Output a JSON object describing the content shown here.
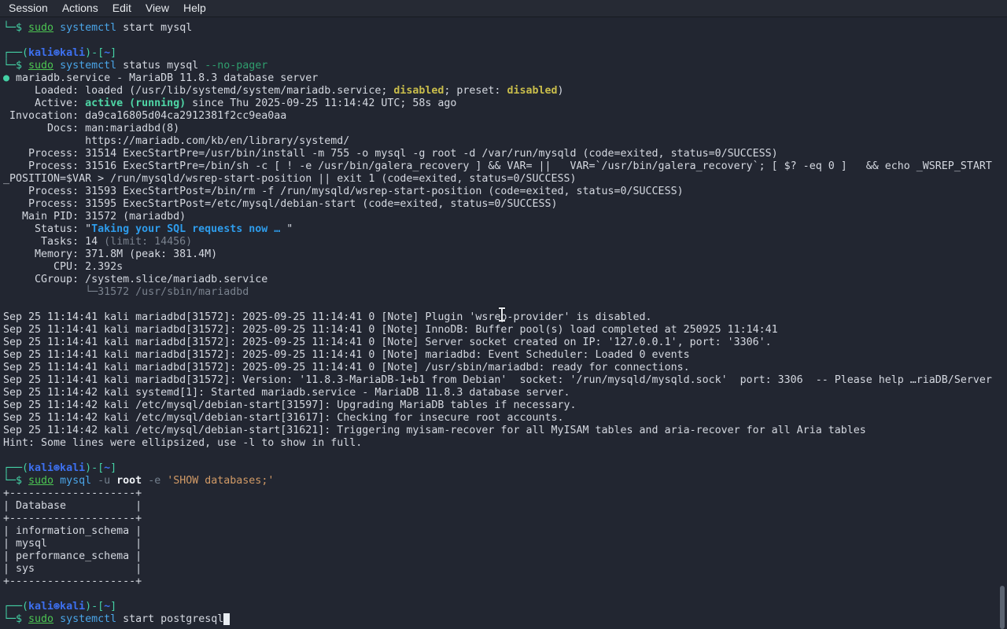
{
  "menubar": {
    "items": [
      "Session",
      "Actions",
      "Edit",
      "View",
      "Help"
    ]
  },
  "palette": {
    "bg": "#222631",
    "menubar": "#262a34",
    "fg": "#d4d8e0",
    "dim": "#7a828e",
    "teal": "#44d1a5",
    "green": "#4cc552",
    "green-bold": "#4fd6a6",
    "yellow": "#c9bd4b",
    "blue-cmd": "#4aa5e8",
    "blue-name": "#3d70f0",
    "blue-status": "#2e9ceb",
    "orange": "#d19a66",
    "opt-green": "#2f9e6e",
    "opt-gray": "#74808e",
    "white-bold": "#eef1f5",
    "cursor": "#e9edf2",
    "scrollbar": "#5b6370"
  },
  "terminal": {
    "lines": [
      [
        {
          "t": "└─$ ",
          "s": "teal"
        },
        {
          "t": "sudo",
          "s": "ul"
        },
        {
          "t": " "
        },
        {
          "t": "systemctl",
          "s": "cmd"
        },
        {
          "t": " start mysql"
        }
      ],
      "",
      [
        {
          "t": "┌──(",
          "s": "teal"
        },
        {
          "t": "kali⊛kali",
          "s": "nb"
        },
        {
          "t": ")-[",
          "s": "teal"
        },
        {
          "t": "~",
          "s": "nb"
        },
        {
          "t": "]",
          "s": "teal"
        }
      ],
      [
        {
          "t": "└─$ ",
          "s": "teal"
        },
        {
          "t": "sudo",
          "s": "ul"
        },
        {
          "t": " "
        },
        {
          "t": "systemctl",
          "s": "cmd"
        },
        {
          "t": " status mysql "
        },
        {
          "t": "--no-pager",
          "s": "optg"
        }
      ],
      [
        {
          "t": "●",
          "s": "teal"
        },
        {
          "t": " mariadb.service - MariaDB 11.8.3 database server"
        }
      ],
      [
        {
          "t": "     Loaded: loaded (/usr/lib/systemd/system/mariadb.service; "
        },
        {
          "t": "disabled",
          "s": "yb"
        },
        {
          "t": "; preset: "
        },
        {
          "t": "disabled",
          "s": "yb"
        },
        {
          "t": ")"
        }
      ],
      [
        {
          "t": "     Active: "
        },
        {
          "t": "active (running)",
          "s": "gb"
        },
        {
          "t": " since Thu 2025-09-25 11:14:42 UTC; 58s ago"
        }
      ],
      " Invocation: da9ca16805d04ca2912381f2cc9ea0aa",
      "       Docs: man:mariadbd(8)",
      "             https://mariadb.com/kb/en/library/systemd/",
      "    Process: 31514 ExecStartPre=/usr/bin/install -m 755 -o mysql -g root -d /var/run/mysqld (code=exited, status=0/SUCCESS)",
      "    Process: 31516 ExecStartPre=/bin/sh -c [ ! -e /usr/bin/galera_recovery ] && VAR= ||   VAR=`/usr/bin/galera_recovery`; [ $? -eq 0 ]   && echo _WSREP_START",
      "_POSITION=$VAR > /run/mysqld/wsrep-start-position || exit 1 (code=exited, status=0/SUCCESS)",
      "    Process: 31593 ExecStartPost=/bin/rm -f /run/mysqld/wsrep-start-position (code=exited, status=0/SUCCESS)",
      "    Process: 31595 ExecStartPost=/etc/mysql/debian-start (code=exited, status=0/SUCCESS)",
      "   Main PID: 31572 (mariadbd)",
      [
        {
          "t": "     Status: \""
        },
        {
          "t": "Taking your SQL requests now … ",
          "s": "sb"
        },
        {
          "t": "\""
        }
      ],
      [
        {
          "t": "      Tasks: 14 "
        },
        {
          "t": "(limit: 14456)",
          "s": "dim"
        }
      ],
      "     Memory: 371.8M (peak: 381.4M)",
      "        CPU: 2.392s",
      "     CGroup: /system.slice/mariadb.service",
      [
        {
          "t": "             "
        },
        {
          "t": "└─31572 /usr/sbin/mariadbd",
          "s": "dim"
        }
      ],
      "",
      "Sep 25 11:14:41 kali mariadbd[31572]: 2025-09-25 11:14:41 0 [Note] Plugin 'wsrep-provider' is disabled.",
      "Sep 25 11:14:41 kali mariadbd[31572]: 2025-09-25 11:14:41 0 [Note] InnoDB: Buffer pool(s) load completed at 250925 11:14:41",
      "Sep 25 11:14:41 kali mariadbd[31572]: 2025-09-25 11:14:41 0 [Note] Server socket created on IP: '127.0.0.1', port: '3306'.",
      "Sep 25 11:14:41 kali mariadbd[31572]: 2025-09-25 11:14:41 0 [Note] mariadbd: Event Scheduler: Loaded 0 events",
      "Sep 25 11:14:41 kali mariadbd[31572]: 2025-09-25 11:14:41 0 [Note] /usr/sbin/mariadbd: ready for connections.",
      "Sep 25 11:14:41 kali mariadbd[31572]: Version: '11.8.3-MariaDB-1+b1 from Debian'  socket: '/run/mysqld/mysqld.sock'  port: 3306  -- Please help …riaDB/Server",
      "Sep 25 11:14:42 kali systemd[1]: Started mariadb.service - MariaDB 11.8.3 database server.",
      "Sep 25 11:14:42 kali /etc/mysql/debian-start[31597]: Upgrading MariaDB tables if necessary.",
      "Sep 25 11:14:42 kali /etc/mysql/debian-start[31617]: Checking for insecure root accounts.",
      "Sep 25 11:14:42 kali /etc/mysql/debian-start[31621]: Triggering myisam-recover for all MyISAM tables and aria-recover for all Aria tables",
      "Hint: Some lines were ellipsized, use -l to show in full.",
      "",
      [
        {
          "t": "┌──(",
          "s": "teal"
        },
        {
          "t": "kali⊛kali",
          "s": "nb"
        },
        {
          "t": ")-[",
          "s": "teal"
        },
        {
          "t": "~",
          "s": "nb"
        },
        {
          "t": "]",
          "s": "teal"
        }
      ],
      [
        {
          "t": "└─$ ",
          "s": "teal"
        },
        {
          "t": "sudo",
          "s": "ul"
        },
        {
          "t": " "
        },
        {
          "t": "mysql",
          "s": "cmd"
        },
        {
          "t": " "
        },
        {
          "t": "-u",
          "s": "opto"
        },
        {
          "t": " "
        },
        {
          "t": "root",
          "s": "wb"
        },
        {
          "t": " "
        },
        {
          "t": "-e",
          "s": "opto"
        },
        {
          "t": " "
        },
        {
          "t": "'SHOW databases;'",
          "s": "str"
        }
      ],
      "+--------------------+",
      "| Database           |",
      "+--------------------+",
      "| information_schema |",
      "| mysql              |",
      "| performance_schema |",
      "| sys                |",
      "+--------------------+",
      "",
      [
        {
          "t": "┌──(",
          "s": "teal"
        },
        {
          "t": "kali⊛kali",
          "s": "nb"
        },
        {
          "t": ")-[",
          "s": "teal"
        },
        {
          "t": "~",
          "s": "nb"
        },
        {
          "t": "]",
          "s": "teal"
        }
      ],
      [
        {
          "t": "└─$ ",
          "s": "teal"
        },
        {
          "t": "sudo",
          "s": "ul"
        },
        {
          "t": " "
        },
        {
          "t": "systemctl",
          "s": "cmd"
        },
        {
          "t": " start postgresql"
        },
        {
          "t": " ",
          "s": "cur"
        }
      ]
    ]
  }
}
